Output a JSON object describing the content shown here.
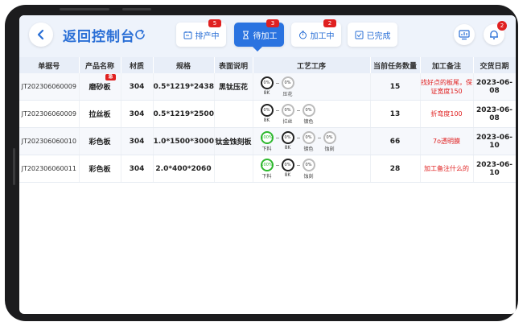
{
  "header": {
    "title": "返回控制台",
    "tabs": [
      {
        "label": "排产中",
        "badge": "5",
        "icon": "calendar-icon",
        "active": false
      },
      {
        "label": "待加工",
        "badge": "3",
        "icon": "hourglass-icon",
        "active": true
      },
      {
        "label": "加工中",
        "badge": "2",
        "icon": "timer-icon",
        "active": false
      },
      {
        "label": "已完成",
        "badge": "",
        "icon": "check-box-icon",
        "active": false
      }
    ],
    "notification_count": "2"
  },
  "table": {
    "columns": [
      "单据号",
      "产品名称",
      "材质",
      "规格",
      "表面说明",
      "工艺工序",
      "当前任务数量",
      "加工备注",
      "交货日期"
    ],
    "rows": [
      {
        "order": "JT202306060009",
        "product": "磨砂板",
        "product_tag": "急",
        "material": "304",
        "spec": "0.5*1219*2438",
        "surface": "黑钛压花",
        "steps": [
          {
            "pct": "0%",
            "label": "8K",
            "style": "dark"
          },
          {
            "pct": "0%",
            "label": "压花",
            "style": "light"
          }
        ],
        "qty": "15",
        "note": "找好点的板尾，保证宽度150",
        "date": "2023-06-08"
      },
      {
        "order": "JT202306060009",
        "product": "拉丝板",
        "product_tag": "",
        "material": "304",
        "spec": "0.5*1219*2500",
        "surface": "",
        "steps": [
          {
            "pct": "0%",
            "label": "8K",
            "style": "dark"
          },
          {
            "pct": "0%",
            "label": "拉丝",
            "style": "light"
          },
          {
            "pct": "0%",
            "label": "镀色",
            "style": "light"
          }
        ],
        "qty": "13",
        "note": "折弯度100",
        "date": "2023-06-08"
      },
      {
        "order": "JT202306060010",
        "product": "彩色板",
        "product_tag": "",
        "material": "304",
        "spec": "1.0*1500*3000",
        "surface": "钛金蚀刻板",
        "steps": [
          {
            "pct": "100%",
            "label": "下料",
            "style": "green"
          },
          {
            "pct": "0%",
            "label": "8K",
            "style": "dark"
          },
          {
            "pct": "0%",
            "label": "镀色",
            "style": "light"
          },
          {
            "pct": "0%",
            "label": "蚀刻",
            "style": "light"
          }
        ],
        "qty": "66",
        "note": "7o透明膜",
        "date": "2023-06-10"
      },
      {
        "order": "JT202306060011",
        "product": "彩色板",
        "product_tag": "",
        "material": "304",
        "spec": "2.0*400*2060",
        "surface": "",
        "steps": [
          {
            "pct": "100%",
            "label": "下料",
            "style": "green"
          },
          {
            "pct": "0%",
            "label": "8K",
            "style": "dark"
          },
          {
            "pct": "0%",
            "label": "蚀刻",
            "style": "light"
          }
        ],
        "qty": "28",
        "note": "加工备注什么的",
        "date": "2023-06-10"
      }
    ]
  }
}
